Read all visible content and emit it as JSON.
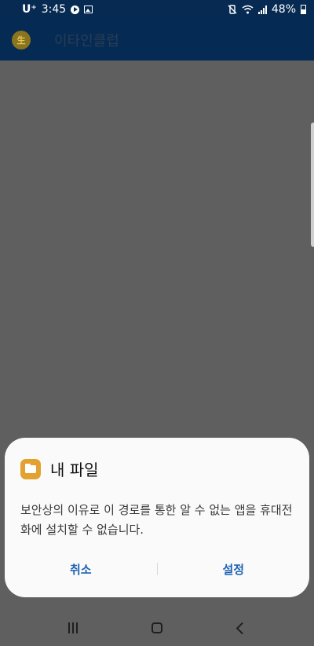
{
  "status_bar": {
    "carrier": "U⁺",
    "time": "3:45",
    "battery": "48%",
    "left_icons": [
      "play-icon",
      "image-icon"
    ],
    "right_icons": [
      "mute-vibrate-icon",
      "wifi-icon",
      "signal-icon",
      "battery-icon"
    ]
  },
  "app_bar": {
    "title": "이타인클럽",
    "logo_icon": "app-logo-icon"
  },
  "dialog": {
    "app_name": "내 파일",
    "app_icon": "folder-icon",
    "message": "보안상의 이유로 이 경로를 통한 알 수 없는 앱을 휴대전화에 설치할 수 없습니다.",
    "cancel_label": "취소",
    "settings_label": "설정",
    "accent_color": "#1f63b3"
  },
  "nav_bar": {
    "icons": [
      "recent-apps-icon",
      "home-icon",
      "back-icon"
    ]
  }
}
